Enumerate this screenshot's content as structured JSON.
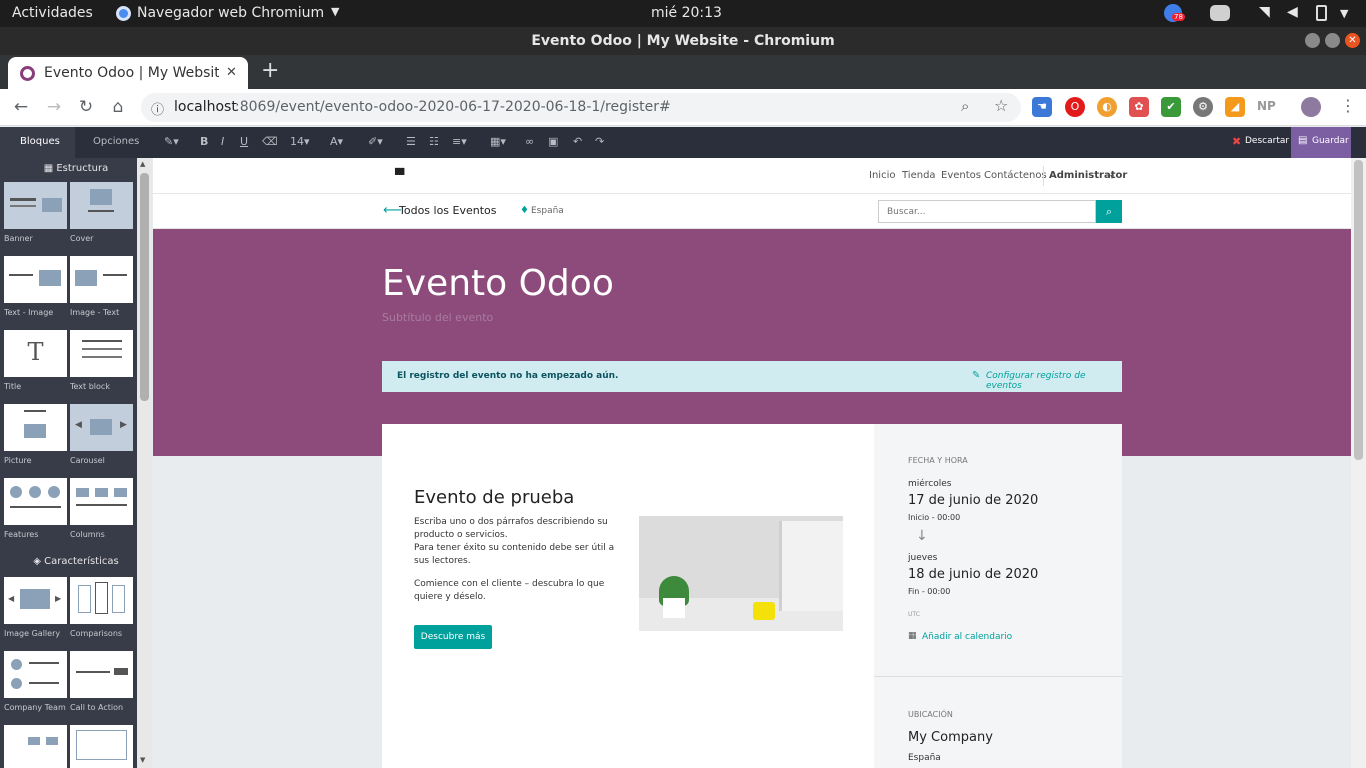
{
  "system_bar": {
    "activities": "Actividades",
    "app_name": "Navegador web Chromium",
    "clock": "mié 20:13",
    "notif_count": "78"
  },
  "window": {
    "title": "Evento Odoo | My Website - Chromium"
  },
  "tab": {
    "title": "Evento Odoo | My Website",
    "new_tab": "+"
  },
  "omnibox": {
    "host": "localhost",
    "path": ":8069/event/evento-odoo-2020-06-17-2020-06-18-1/register#"
  },
  "extensions": {
    "np_label": "NP"
  },
  "editor": {
    "font_size": "14",
    "discard_label": "Descartar",
    "save_label": "Guardar"
  },
  "sidebar": {
    "tab_blocks": "Bloques",
    "tab_options": "Opciones",
    "section_structure": "Estructura",
    "section_features": "Características",
    "snippets": [
      {
        "label": "Banner"
      },
      {
        "label": "Cover"
      },
      {
        "label": "Text - Image"
      },
      {
        "label": "Image - Text"
      },
      {
        "label": "Title"
      },
      {
        "label": "Text block"
      },
      {
        "label": "Picture"
      },
      {
        "label": "Carousel"
      },
      {
        "label": "Features"
      },
      {
        "label": "Columns"
      },
      {
        "label": "Image Gallery"
      },
      {
        "label": "Comparisons"
      },
      {
        "label": "Company Team"
      },
      {
        "label": "Call to Action"
      }
    ]
  },
  "site_nav": {
    "items": [
      "Inicio",
      "Tienda",
      "Eventos",
      "Contáctenos"
    ],
    "user": "Administrator"
  },
  "event_bar": {
    "back": "Todos los Eventos",
    "location": "España",
    "search_placeholder": "Buscar..."
  },
  "hero": {
    "title": "Evento Odoo",
    "subtitle": "Subtítulo del evento"
  },
  "alert": {
    "message": "El registro del evento no ha empezado aún.",
    "link": "Configurar registro de eventos"
  },
  "content": {
    "heading": "Evento de prueba",
    "p1": "Escriba uno o dos párrafos describiendo su producto o servicios.",
    "p2": "Para tener éxito su contenido debe ser útil a sus lectores.",
    "p3": "Comience con el cliente – descubra lo que quiere y déselo.",
    "button": "Descubre más"
  },
  "details": {
    "date_header": "FECHA Y HORA",
    "start_day": "miércoles",
    "start_date": "17 de junio de 2020",
    "start_time": "Inicio - 00:00",
    "end_day": "jueves",
    "end_date": "18 de junio de 2020",
    "end_time": "Fin - 00:00",
    "timezone": "UTC",
    "add_calendar": "Añadir al calendario",
    "location_header": "UBICACIÓN",
    "company": "My Company",
    "country": "España"
  },
  "colors": {
    "hero": "#8d4b7c",
    "primary": "#00a09d",
    "editor_bar": "#2b2e3b",
    "save": "#7c5ea3"
  }
}
